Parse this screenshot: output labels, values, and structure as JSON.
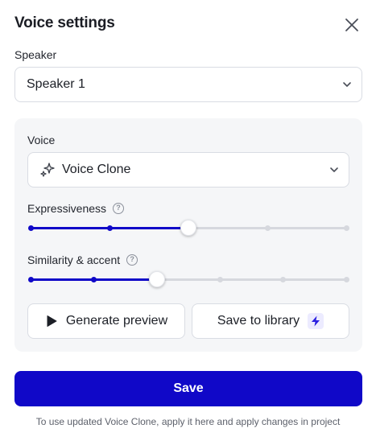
{
  "dialog": {
    "title": "Voice settings"
  },
  "speaker": {
    "label": "Speaker",
    "selected": "Speaker 1"
  },
  "voice": {
    "label": "Voice",
    "selected": "Voice Clone"
  },
  "sliders": {
    "expressiveness": {
      "label": "Expressiveness",
      "value": 0.5,
      "steps": 5
    },
    "similarity": {
      "label": "Similarity & accent",
      "value": 0.4,
      "steps": 6
    }
  },
  "buttons": {
    "generate_preview": "Generate preview",
    "save_to_library": "Save to library",
    "save": "Save"
  },
  "footnote": "To use updated Voice Clone, apply it here and apply changes in project",
  "colors": {
    "accent": "#1008c8",
    "track": "#d6d8de",
    "panel": "#f5f6f8"
  },
  "icons": {
    "close": "close-icon",
    "chevron": "chevron-down-icon",
    "sparkle": "sparkle-icon",
    "help": "help-circle-icon",
    "play": "play-icon",
    "bolt": "lightning-bolt-icon"
  }
}
